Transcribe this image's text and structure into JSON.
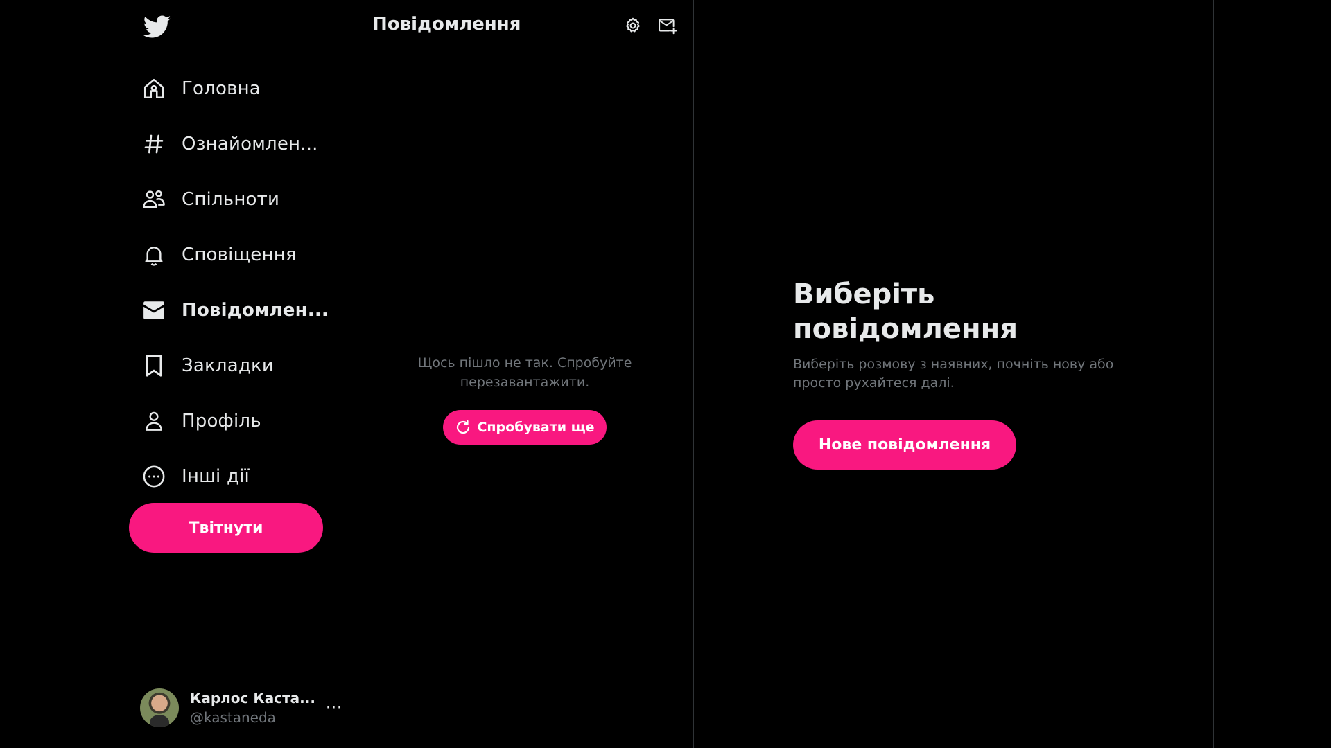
{
  "sidebar": {
    "logo": "twitter-bird-icon",
    "items": [
      {
        "label": "Головна",
        "icon": "home-icon"
      },
      {
        "label": "Ознайомлен...",
        "icon": "hashtag-icon"
      },
      {
        "label": "Спільноти",
        "icon": "communities-icon"
      },
      {
        "label": "Сповіщення",
        "icon": "bell-icon"
      },
      {
        "label": "Повідомлен...",
        "icon": "envelope-icon",
        "active": true
      },
      {
        "label": "Закладки",
        "icon": "bookmark-icon"
      },
      {
        "label": "Профіль",
        "icon": "person-icon"
      },
      {
        "label": "Інші дії",
        "icon": "more-circle-icon"
      }
    ],
    "tweet_button": "Твітнути",
    "account": {
      "name": "Карлос Каста...",
      "handle": "@kastaneda",
      "more": "···"
    }
  },
  "messages": {
    "title": "Повідомлення",
    "settings_icon": "gear-icon",
    "compose_icon": "new-message-icon",
    "error_text": "Щось пішло не так. Спробуйте перезавантажити.",
    "retry_button": "Спробувати ще"
  },
  "detail": {
    "title": "Виберіть повідомлення",
    "subtitle": "Виберіть розмову з наявних, почніть нову або просто рухайтеся далі.",
    "new_message_button": "Нове повідомлення"
  },
  "colors": {
    "accent": "#f91880",
    "background": "#000000",
    "text": "#e7e9ea",
    "muted": "#71767b",
    "border": "#2f3336"
  }
}
